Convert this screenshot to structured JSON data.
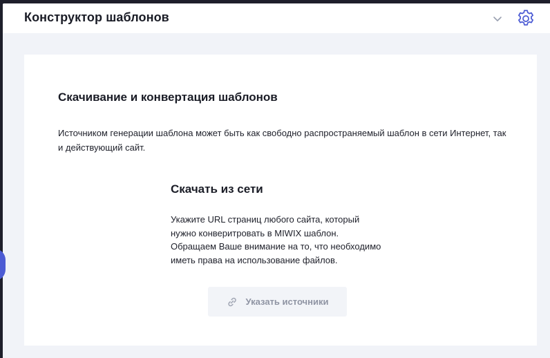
{
  "header": {
    "title": "Конструктор шаблонов",
    "chevron_icon": "chevron-down-icon",
    "settings_icon": "gear-icon"
  },
  "card": {
    "title": "Скачивание и конвертация шаблонов",
    "description": "Источником генерации шаблона может быть как свободно распространяемый шаблон в сети Интернет, так и действующий сайт."
  },
  "download": {
    "title": "Скачать из сети",
    "lines": [
      "Укажите URL страниц любого сайта, который",
      "нужно конверитровать в MIWIX шаблон.",
      "Обращаем Ваше внимание на то, что необходимо",
      "иметь права на использование файлов."
    ],
    "button_label": "Указать источники",
    "button_icon": "link-icon"
  },
  "colors": {
    "accent": "#4c5bd4",
    "page_background": "#f1f3f8",
    "frame_background": "#1e1f2b",
    "text": "#1a1c26",
    "button_text_disabled": "#8f94a3"
  }
}
